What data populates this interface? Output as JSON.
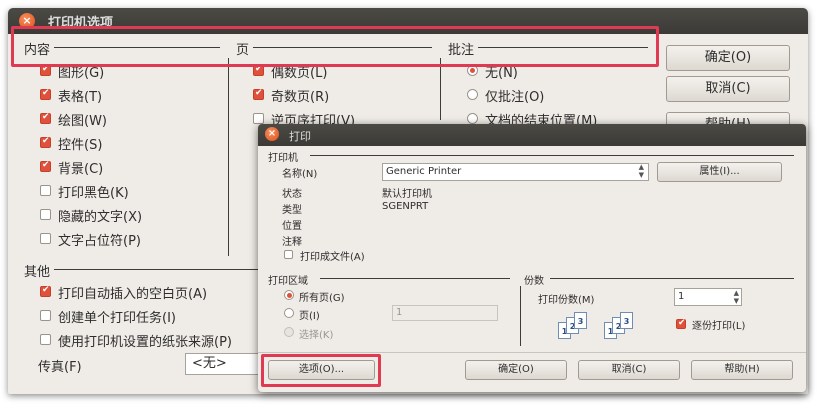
{
  "back_dialog": {
    "title": "打印机选项",
    "sections": {
      "content": "内容",
      "pages": "页",
      "notes": "批注",
      "other": "其他"
    },
    "content_items": [
      {
        "label": "图形(G)",
        "checked": true
      },
      {
        "label": "表格(T)",
        "checked": true
      },
      {
        "label": "绘图(W)",
        "checked": true
      },
      {
        "label": "控件(S)",
        "checked": true
      },
      {
        "label": "背景(C)",
        "checked": true
      },
      {
        "label": "打印黑色(K)",
        "checked": false
      },
      {
        "label": "隐藏的文字(X)",
        "checked": false
      },
      {
        "label": "文字占位符(P)",
        "checked": false
      }
    ],
    "pages_items": [
      {
        "label": "偶数页(L)",
        "checked": true
      },
      {
        "label": "奇数页(R)",
        "checked": true
      },
      {
        "label": "逆页序打印(V)",
        "checked": false
      }
    ],
    "notes_items": [
      {
        "label": "无(N)",
        "selected": true
      },
      {
        "label": "仅批注(O)",
        "selected": false
      },
      {
        "label": "文档的结束位置(M)",
        "selected": false
      }
    ],
    "other_items": [
      {
        "label": "打印自动插入的空白页(A)",
        "checked": true
      },
      {
        "label": "创建单个打印任务(I)",
        "checked": false
      },
      {
        "label": "使用打印机设置的纸张来源(P)",
        "checked": false
      }
    ],
    "fax_label": "传真(F)",
    "fax_value": "<无>",
    "buttons": {
      "ok": "确定(O)",
      "cancel": "取消(C)",
      "help": "帮助(H)"
    }
  },
  "print_dialog": {
    "title": "打印",
    "printer_section": "打印机",
    "name_label": "名称(N)",
    "printer_name": "Generic Printer",
    "properties_button": "属性(I)...",
    "status_label": "状态",
    "status_value": "默认打印机",
    "type_label": "类型",
    "type_value": "SGENPRT",
    "location_label": "位置",
    "comment_label": "注释",
    "print_to_file": "打印成文件(A)",
    "range_section": "打印区域",
    "all_pages": "所有页(G)",
    "pages": "页(I)",
    "pages_value": "1",
    "selection": "选择(K)",
    "copies_section": "份数",
    "copies_label": "打印份数(M)",
    "copies_value": "1",
    "collate": "逐份打印(L)",
    "buttons": {
      "options": "选项(O)...",
      "ok": "确定(O)",
      "cancel": "取消(C)",
      "help": "帮助(H)"
    }
  },
  "colors": {
    "accent": "#e0513c",
    "highlight": "#e03a52",
    "titlebar": "#3c3b37",
    "dialog_bg": "#efebe6"
  },
  "icons": {
    "close": "close-icon",
    "collate_pages": "collate-pages-icon"
  }
}
